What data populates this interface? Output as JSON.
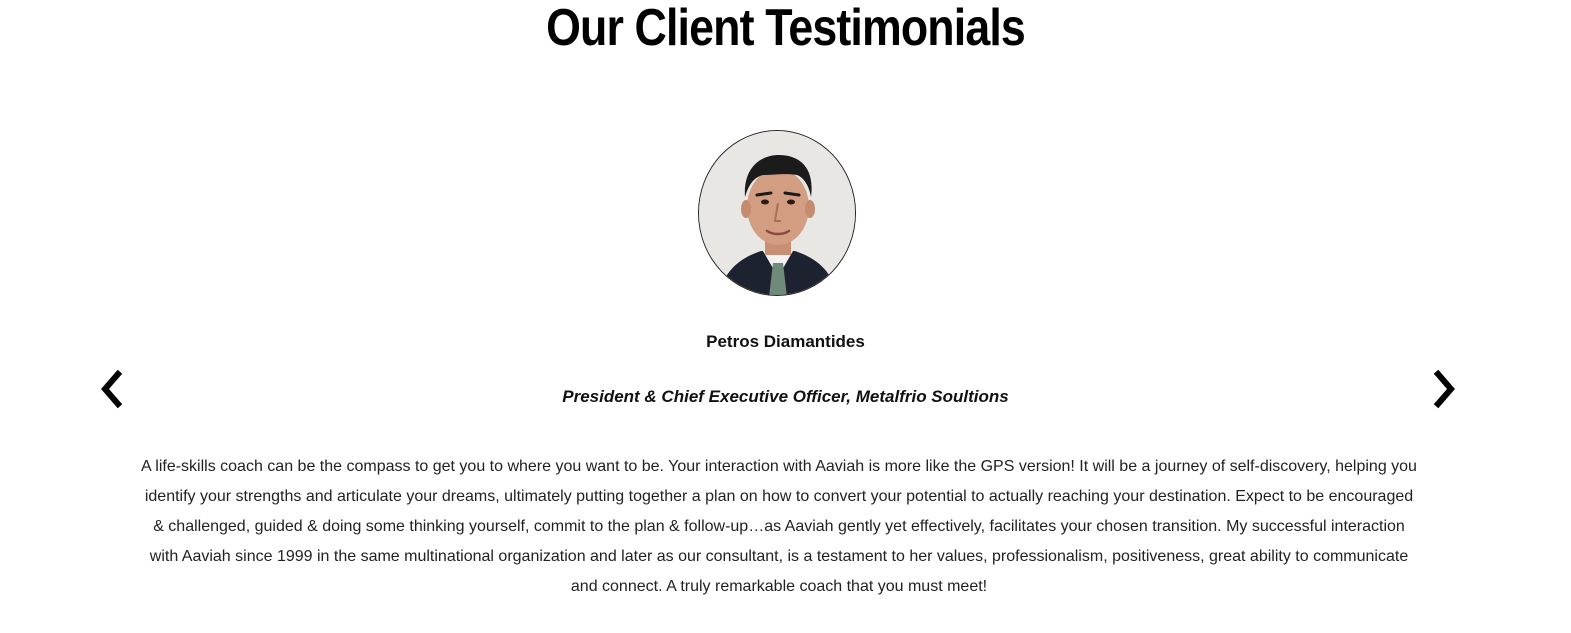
{
  "section": {
    "title": "Our Client Testimonials"
  },
  "testimonial": {
    "avatar_alt": "Petros Diamantides",
    "name": "Petros Diamantides",
    "role": "President & Chief Executive Officer, Metalfrio Soultions",
    "quote": "A life-skills coach can be the compass to get you to where you want to be. Your interaction with Aaviah is more like the GPS version! It will be a journey of self-discovery, helping you identify your strengths and articulate your dreams, ultimately putting together a plan on how to convert your potential to actually reaching your destination. Expect to be encouraged & challenged, guided & doing some thinking yourself, commit to the plan & follow-up…as Aaviah gently yet effectively, facilitates your chosen transition. My successful interaction with Aaviah since 1999 in the same multinational organization and later as our consultant, is a testament to her values, professionalism, positiveness, great ability to communicate and connect. A truly remarkable coach that you must meet!"
  },
  "carousel": {
    "prev_icon": "chevron-left-icon",
    "next_icon": "chevron-right-icon"
  },
  "colors": {
    "text": "#111111",
    "background": "#ffffff",
    "arrow": "#000000"
  }
}
